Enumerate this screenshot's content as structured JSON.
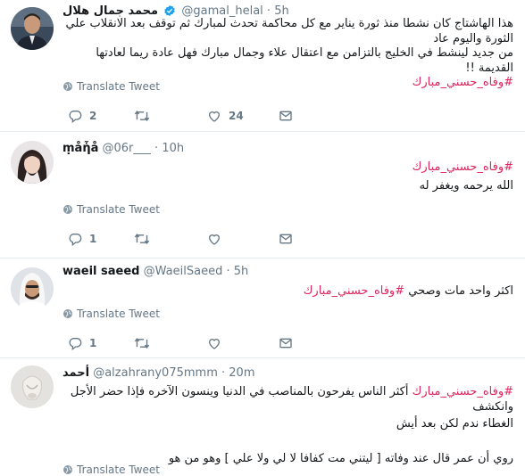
{
  "tweets": [
    {
      "name": "محمد جمال هلال",
      "handle": "@gamal_helal",
      "dot": "·",
      "time": "5h",
      "verified": true,
      "lines": [
        {
          "segments": [
            {
              "text": "هذا الهاشتاج كان نشطا منذ ثورة يناير مع كل محاكمة تحدث لمبارك ثم توقف بعد الانقلاب علي الثورة واليوم عاد",
              "tag": false
            }
          ]
        },
        {
          "segments": [
            {
              "text": "من جديد لينشط في الخليج بالتزامن مع اعتقال علاء وجمال مبارك فهل عادة ريما لعادتها القديمة !!",
              "tag": false
            }
          ]
        },
        {
          "segments": [
            {
              "text": "#وفاه_حسني_مبارك",
              "tag": true
            }
          ]
        }
      ],
      "translate": "Translate Tweet",
      "reply_count": "2",
      "retweet_count": "",
      "like_count": "24"
    },
    {
      "name": "ṃåἧå",
      "handle": "@06r___",
      "dot": "·",
      "time": "10h",
      "verified": false,
      "lines": [
        {
          "segments": [
            {
              "text": "#وفاه_حسني_مبارك",
              "tag": true
            }
          ]
        },
        {
          "segments": [
            {
              "text": "الله يرحمه ويغفر له",
              "tag": false
            }
          ]
        }
      ],
      "translate": "Translate Tweet",
      "reply_count": "1",
      "retweet_count": "",
      "like_count": ""
    },
    {
      "name": "waeil saeed",
      "handle": "@WaeilSaeed",
      "dot": "·",
      "time": "5h",
      "verified": false,
      "lines": [
        {
          "segments": [
            {
              "text": "اكثر واحد مات وصحي ",
              "tag": false
            },
            {
              "text": "#وفاه_حسني_مبارك",
              "tag": true
            }
          ]
        }
      ],
      "translate": "Translate Tweet",
      "reply_count": "1",
      "retweet_count": "",
      "like_count": ""
    },
    {
      "name": "أحمد",
      "handle": "@alzahrany075mmm",
      "dot": "·",
      "time": "20m",
      "verified": false,
      "lines": [
        {
          "segments": [
            {
              "text": "#وفاه_حسني_مبارك",
              "tag": true
            },
            {
              "text": " أكثر الناس يفرحون بالمناصب في الدنيا وينسون الآخره فإذا حضر الأجل وانكشف",
              "tag": false
            }
          ]
        },
        {
          "segments": [
            {
              "text": "الغطاء ندم لكن بعد أيش",
              "tag": false
            }
          ]
        },
        {
          "segments": [
            {
              "text": "",
              "tag": false
            }
          ]
        },
        {
          "segments": [
            {
              "text": "روي أن عمر قال عند وفاته [ ليتني مت كفافا لا لي ولا علي ] وهو من هو",
              "tag": false
            }
          ]
        }
      ],
      "translate": "Translate Tweet",
      "reply_count": "",
      "retweet_count": "",
      "like_count": ""
    }
  ],
  "colors": {
    "hashtag": "#e0245e",
    "meta": "#657786",
    "verified": "#1da1f2",
    "divider": "#e6ecf0"
  },
  "icons": [
    "verified-badge-icon",
    "globe-icon",
    "reply-icon",
    "retweet-icon",
    "like-icon",
    "dm-icon"
  ]
}
